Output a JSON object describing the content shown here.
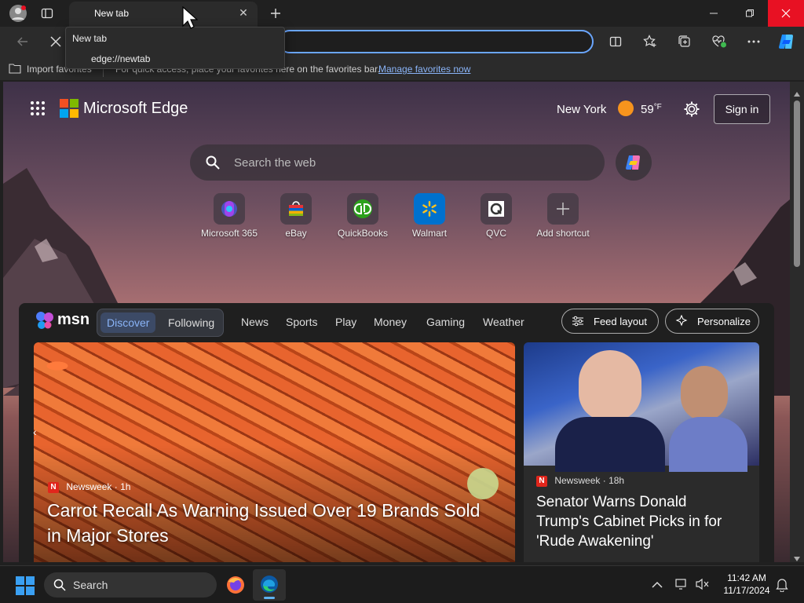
{
  "browser": {
    "tab_title": "New tab",
    "tooltip_title": "New tab",
    "tooltip_url": "edge://newtab",
    "favorites_label": "Import favorites",
    "favorites_hint": "For quick access, place your favorites here on the favorites bar.",
    "manage_favorites_link": "Manage favorites now"
  },
  "newtab": {
    "brand": "Microsoft Edge",
    "location": "New York",
    "temperature": "59",
    "temp_unit": "°F",
    "sign_in": "Sign in",
    "search_placeholder": "Search the web",
    "shortcuts": [
      {
        "label": "Microsoft 365"
      },
      {
        "label": "eBay"
      },
      {
        "label": "QuickBooks"
      },
      {
        "label": "Walmart"
      },
      {
        "label": "QVC"
      },
      {
        "label": "Add shortcut"
      }
    ]
  },
  "msn": {
    "logo": "msn",
    "tabs": [
      "Discover",
      "Following"
    ],
    "nav": [
      "News",
      "Sports",
      "Play",
      "Money",
      "Gaming",
      "Weather"
    ],
    "feed_layout": "Feed layout",
    "personalize": "Personalize",
    "main_card": {
      "source": "Newsweek",
      "age": "1h",
      "headline_line1": "Carrot Recall As Warning Issued Over 19 Brands Sold",
      "headline_line2": "in Major Stores"
    },
    "side_card": {
      "source": "Newsweek",
      "age": "18h",
      "headline_line1": "Senator Warns Donald",
      "headline_line2": "Trump's Cabinet Picks in for",
      "headline_line3": "'Rude Awakening'"
    }
  },
  "taskbar": {
    "search_label": "Search",
    "time": "11:42 AM",
    "date": "11/17/2024"
  },
  "colors": {
    "accent": "#6aa6ff",
    "close_red": "#e81123",
    "link": "#8ab4f8"
  }
}
